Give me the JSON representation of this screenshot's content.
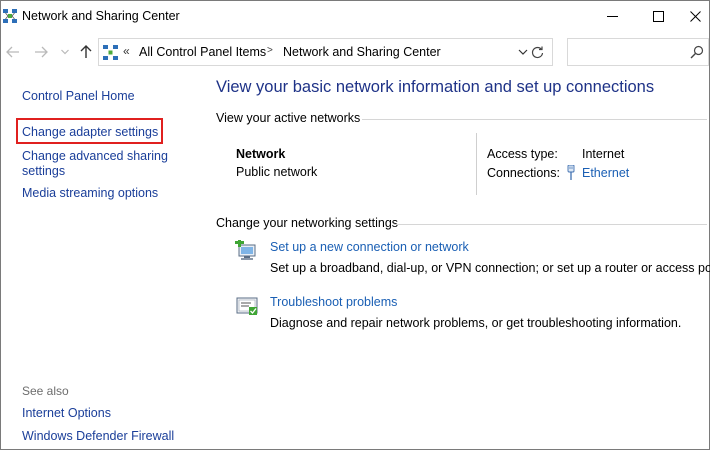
{
  "window": {
    "title": "Network and Sharing Center"
  },
  "address_bar": {
    "breadcrumb_overflow": "«",
    "crumbs": [
      "All Control Panel Items",
      "Network and Sharing Center"
    ],
    "separator_icon": "chevron-right-icon",
    "search_placeholder": ""
  },
  "left_pane": {
    "links": {
      "home": "Control Panel Home",
      "adapter": "Change adapter settings",
      "advanced_line1": "Change advanced sharing",
      "advanced_line2": "settings",
      "media": "Media streaming options"
    },
    "see_also": {
      "heading": "See also",
      "internet_options": "Internet Options",
      "firewall": "Windows Defender Firewall"
    }
  },
  "main": {
    "title": "View your basic network information and set up connections",
    "active_networks": {
      "heading": "View your active networks",
      "network_name": "Network",
      "network_category": "Public network",
      "access_type_label": "Access type:",
      "access_type_value": "Internet",
      "connections_label": "Connections:",
      "connections_value": "Ethernet"
    },
    "change_settings": {
      "heading": "Change your networking settings",
      "tasks": [
        {
          "link": "Set up a new connection or network",
          "description": "Set up a broadband, dial-up, or VPN connection; or set up a router or access point.",
          "icon": "new-connection-icon"
        },
        {
          "link": "Troubleshoot problems",
          "description": "Diagnose and repair network problems, or get troubleshooting information.",
          "icon": "troubleshoot-icon"
        }
      ]
    }
  },
  "colors": {
    "link": "#1a5fb4",
    "nav_link": "#1a3e99",
    "title": "#1e3287",
    "highlight": "#e0201f"
  }
}
